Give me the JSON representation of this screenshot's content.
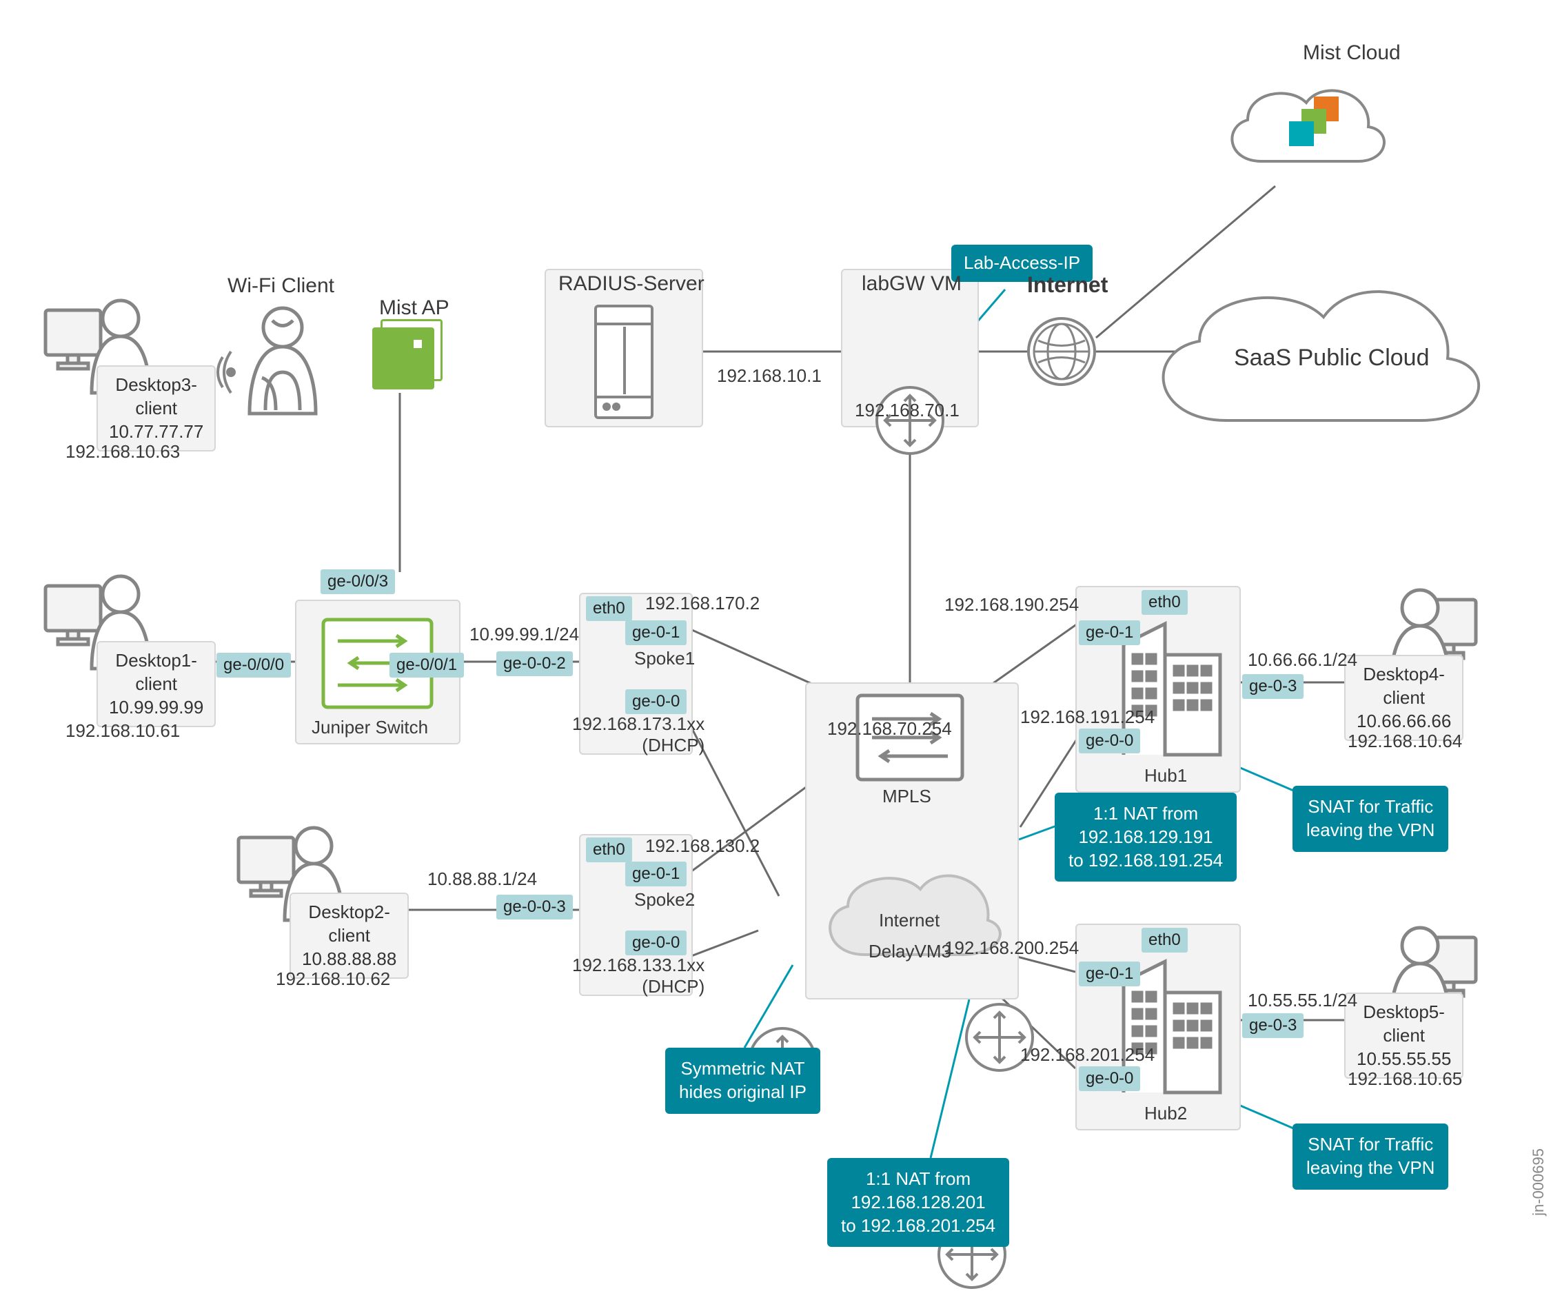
{
  "diagram_id": "jn-000695",
  "clouds": {
    "mist": "Mist Cloud",
    "saas": "SaaS Public Cloud",
    "internet_label": "Internet",
    "internet_inner": "Internet"
  },
  "top_row": {
    "wifi_client": "Wi-Fi Client",
    "mist_ap": "Mist AP",
    "radius_server": "RADIUS-Server",
    "labgw_vm": "labGW VM",
    "lab_access_ip": "Lab-Access-IP",
    "labgw_left_ip": "192.168.10.1",
    "labgw_bottom_ip": "192.168.70.1"
  },
  "desktops": {
    "d1": {
      "name": "Desktop1-\nclient",
      "ip": "10.99.99.99",
      "mgmt": "192.168.10.61"
    },
    "d2": {
      "name": "Desktop2-\nclient",
      "ip": "10.88.88.88",
      "mgmt": "192.168.10.62"
    },
    "d3": {
      "name": "Desktop3-\nclient",
      "ip": "10.77.77.77",
      "mgmt": "192.168.10.63"
    },
    "d4": {
      "name": "Desktop4-\nclient",
      "ip": "10.66.66.66",
      "mgmt": "192.168.10.64"
    },
    "d5": {
      "name": "Desktop5-\nclient",
      "ip": "10.55.55.55",
      "mgmt": "192.168.10.65"
    }
  },
  "switch": {
    "label": "Juniper Switch",
    "ports": {
      "p0": "ge-0/0/0",
      "p1": "ge-0/0/1",
      "p3": "ge-0/0/3"
    }
  },
  "spoke1": {
    "name": "Spoke1",
    "eth0": "eth0",
    "ge01": "ge-0-1",
    "ge00": "ge-0-0",
    "ge002": "ge-0-0-2",
    "lan_ip": "10.99.99.1/24",
    "eth0_ip": "192.168.170.2",
    "wan_ip": "192.168.173.1xx\n(DHCP)"
  },
  "spoke2": {
    "name": "Spoke2",
    "eth0": "eth0",
    "ge01": "ge-0-1",
    "ge00": "ge-0-0",
    "ge003": "ge-0-0-3",
    "lan_ip": "10.88.88.1/24",
    "eth0_ip": "192.168.130.2",
    "wan_ip": "192.168.133.1xx\n(DHCP)"
  },
  "hub1": {
    "name": "Hub1",
    "eth0": "eth0",
    "ge01": "ge-0-1",
    "ge00": "ge-0-0",
    "ge03": "ge-0-3",
    "eth0_ip": "192.168.190.254",
    "ge00_ip": "192.168.191.254",
    "lan_ip": "10.66.66.1/24"
  },
  "hub2": {
    "name": "Hub2",
    "eth0": "eth0",
    "ge01": "ge-0-1",
    "ge00": "ge-0-0",
    "ge03": "ge-0-3",
    "eth0_ip": "192.168.200.254",
    "ge00_ip": "192.168.201.254",
    "lan_ip": "10.55.55.1/24"
  },
  "core": {
    "mpls": "MPLS",
    "mpls_top_ip": "192.168.70.254",
    "delayvm": "DelayVM3"
  },
  "callouts": {
    "symmetric_nat": "Symmetric NAT\nhides original IP",
    "nat_191": "1:1 NAT from\n192.168.129.191\nto 192.168.191.254",
    "nat_201": "1:1 NAT from\n192.168.128.201\nto 192.168.201.254",
    "snat1": "SNAT for Traffic\nleaving the VPN",
    "snat2": "SNAT for Traffic\nleaving the VPN"
  }
}
